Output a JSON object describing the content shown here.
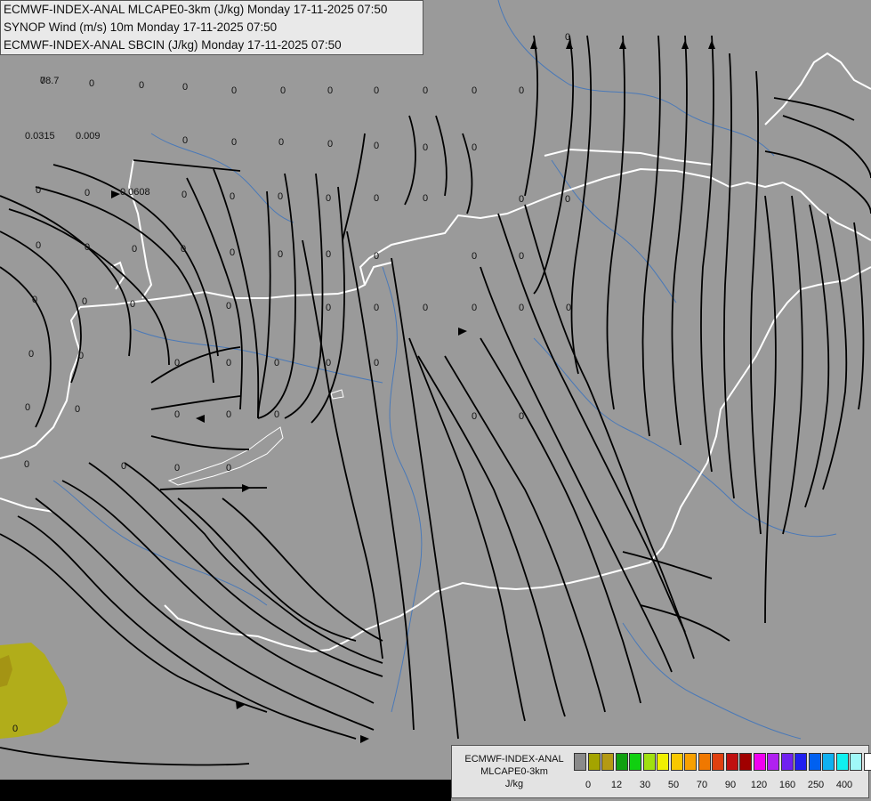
{
  "header": {
    "line1": "ECMWF-INDEX-ANAL MLCAPE0-3km (J/kg) Monday 17-11-2025 07:50",
    "line2": "SYNOP Wind (m/s) 10m Monday 17-11-2025 07:50",
    "line3": "ECMWF-INDEX-ANAL SBCIN (J/kg) Monday 17-11-2025 07:50"
  },
  "colors": {
    "background": "#9a9a9a",
    "border_line": "#ffffff",
    "river": "#4a79b8",
    "streamline": "#000000",
    "cape_patch": "#b1ad1a"
  },
  "map_values": [
    {
      "id": "v1",
      "text": "0"
    },
    {
      "id": "v2",
      "text": "0"
    },
    {
      "id": "v3",
      "text": "0"
    },
    {
      "id": "v4",
      "text": "0"
    },
    {
      "id": "v5",
      "text": "0"
    },
    {
      "id": "v6",
      "text": "0"
    },
    {
      "id": "v7",
      "text": "0"
    },
    {
      "id": "v8",
      "text": "0"
    },
    {
      "id": "v9",
      "text": "0"
    },
    {
      "id": "v10",
      "text": "0"
    },
    {
      "id": "v11",
      "text": "0"
    },
    {
      "id": "v12",
      "text": "0"
    },
    {
      "id": "v13",
      "text": "0.0315"
    },
    {
      "id": "v14",
      "text": "0.009"
    },
    {
      "id": "v15",
      "text": "0.0608"
    },
    {
      "id": "v16",
      "text": "0"
    },
    {
      "id": "v17",
      "text": "0"
    },
    {
      "id": "v18",
      "text": "0"
    },
    {
      "id": "v19",
      "text": "0"
    },
    {
      "id": "v20",
      "text": "0"
    },
    {
      "id": "v21",
      "text": "0"
    },
    {
      "id": "v22",
      "text": "0"
    },
    {
      "id": "v23",
      "text": "0"
    },
    {
      "id": "v24",
      "text": "0"
    },
    {
      "id": "v25",
      "text": "0"
    },
    {
      "id": "v26",
      "text": "0"
    },
    {
      "id": "v27",
      "text": "0"
    },
    {
      "id": "v28",
      "text": "0"
    },
    {
      "id": "v29",
      "text": "0"
    },
    {
      "id": "v30",
      "text": "0"
    },
    {
      "id": "v31",
      "text": "0"
    },
    {
      "id": "v32",
      "text": "0"
    },
    {
      "id": "v33",
      "text": "0"
    },
    {
      "id": "v34",
      "text": "0"
    },
    {
      "id": "v35",
      "text": "0"
    },
    {
      "id": "v36",
      "text": "0"
    },
    {
      "id": "v37",
      "text": "0"
    },
    {
      "id": "v38",
      "text": "0"
    },
    {
      "id": "v39",
      "text": "0"
    },
    {
      "id": "v40",
      "text": "0"
    },
    {
      "id": "v41",
      "text": "0"
    },
    {
      "id": "v42",
      "text": "0"
    },
    {
      "id": "v43",
      "text": "0"
    },
    {
      "id": "v44",
      "text": "0"
    },
    {
      "id": "v45",
      "text": "0"
    },
    {
      "id": "v46",
      "text": "0"
    },
    {
      "id": "v47",
      "text": "0"
    },
    {
      "id": "v48",
      "text": "0"
    },
    {
      "id": "v49",
      "text": "0"
    },
    {
      "id": "v50",
      "text": "0"
    },
    {
      "id": "v51",
      "text": "0"
    },
    {
      "id": "v52",
      "text": "0"
    },
    {
      "id": "v53",
      "text": "0"
    },
    {
      "id": "v54",
      "text": "0"
    },
    {
      "id": "v55",
      "text": "0"
    },
    {
      "id": "v56",
      "text": "0"
    },
    {
      "id": "v57",
      "text": "0"
    },
    {
      "id": "v58",
      "text": "0"
    },
    {
      "id": "v59",
      "text": "0"
    },
    {
      "id": "v60",
      "text": "0"
    },
    {
      "id": "v61",
      "text": "0"
    },
    {
      "id": "v62",
      "text": "0"
    },
    {
      "id": "v63",
      "text": "0"
    },
    {
      "id": "v64",
      "text": "0"
    },
    {
      "id": "v65",
      "text": "0"
    },
    {
      "id": "v66",
      "text": "0"
    },
    {
      "id": "v67",
      "text": "0"
    },
    {
      "id": "v68",
      "text": "0"
    },
    {
      "id": "v69",
      "text": "0"
    },
    {
      "id": "v70",
      "text": "0"
    },
    {
      "id": "v71",
      "text": "0"
    },
    {
      "id": "v72",
      "text": "78.7"
    }
  ],
  "legend": {
    "title_line1": "ECMWF-INDEX-ANAL",
    "title_line2": "MLCAPE0-3km",
    "unit": "J/kg",
    "swatch_colors": [
      "#8a8a8a",
      "#a4a400",
      "#b49a14",
      "#10a010",
      "#10d010",
      "#a0e010",
      "#f0f000",
      "#f8c800",
      "#f8a000",
      "#f07800",
      "#e04010",
      "#c01010",
      "#a00000",
      "#f000f0",
      "#b020f0",
      "#7020f0",
      "#2020f0",
      "#0060f0",
      "#10b0f0",
      "#10f0f0",
      "#a0f8f8",
      "#ffffff"
    ],
    "tick_labels": [
      "0",
      "12",
      "30",
      "50",
      "70",
      "90",
      "120",
      "160",
      "250",
      "400"
    ]
  }
}
